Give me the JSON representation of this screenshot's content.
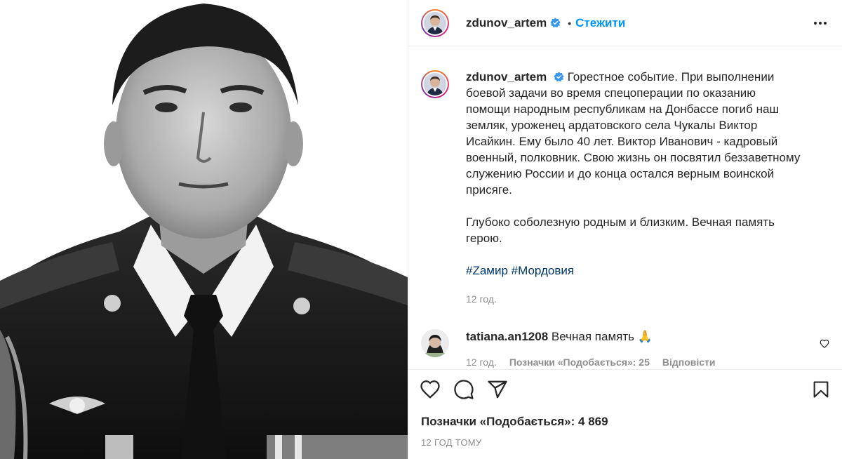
{
  "post": {
    "author": "zdunov_artem",
    "follow_label": "Стежити",
    "header_dot": "•",
    "caption": {
      "username": "zdunov_artem",
      "text": "Горестное событие. При выполнении боевой задачи во время спецоперации по оказанию помощи народным республикам на Донбассе погиб наш земляк, уроженец ардатовского села Чукалы Виктор Исайкин. Ему было 40 лет. Виктор Иванович - кадровый военный, полковник. Свою жизнь он посвятил беззаветному служению России и до конца остался верным воинской присяге.",
      "text2": "Глубоко соболезную родным и близким. Вечная память герою.",
      "hashtags": [
        "#Zамир",
        "#Мордовия"
      ],
      "time": "12 год."
    },
    "comment": {
      "username": "tatiana.an1208",
      "text": "Вечная память 🙏",
      "time": "12 год.",
      "likes_label": "Позначки «Подобається»: 25",
      "reply_label": "Відповісти"
    },
    "likes_label": "Позначки «Подобається»: 4 869",
    "posted_time": "12 ГОД ТОМУ"
  },
  "icons": [
    "verified-badge-icon",
    "more-options-icon",
    "heart-icon",
    "comment-icon",
    "share-icon",
    "bookmark-icon"
  ],
  "colors": {
    "link_blue": "#0095f6",
    "hashtag": "#00376b",
    "muted": "#8e8e8e",
    "text": "#262626",
    "verified": "#3897f0"
  }
}
